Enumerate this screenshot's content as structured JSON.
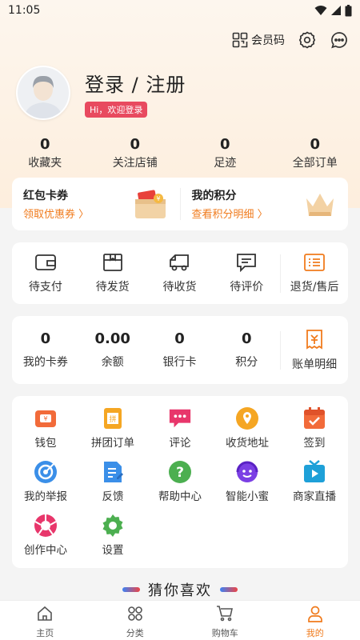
{
  "status_bar": {
    "time": "11:05"
  },
  "header": {
    "member_code_label": "会员码"
  },
  "profile": {
    "login_text": "登录 / 注册",
    "welcome_badge": "Hi，欢迎登录"
  },
  "stats": [
    {
      "value": "0",
      "label": "收藏夹"
    },
    {
      "value": "0",
      "label": "关注店铺"
    },
    {
      "value": "0",
      "label": "足迹"
    },
    {
      "value": "0",
      "label": "全部订单"
    }
  ],
  "promo": {
    "coupons": {
      "title": "红包卡券",
      "subtitle": "领取优惠券 〉"
    },
    "points": {
      "title": "我的积分",
      "subtitle": "查看积分明细 〉"
    }
  },
  "orders": [
    {
      "label": "待支付",
      "icon": "wallet-icon"
    },
    {
      "label": "待发货",
      "icon": "box-icon"
    },
    {
      "label": "待收货",
      "icon": "truck-icon"
    },
    {
      "label": "待评价",
      "icon": "comment-icon"
    },
    {
      "label": "退货/售后",
      "icon": "return-icon"
    }
  ],
  "wallet": [
    {
      "value": "0",
      "label": "我的卡券"
    },
    {
      "value": "0.00",
      "label": "余额"
    },
    {
      "value": "0",
      "label": "银行卡"
    },
    {
      "value": "0",
      "label": "积分"
    }
  ],
  "bill_detail_label": "账单明细",
  "services": [
    {
      "label": "钱包",
      "icon": "wallet-icon",
      "color": "#f26b3a"
    },
    {
      "label": "拼团订单",
      "icon": "group-order-icon",
      "color": "#f5a623"
    },
    {
      "label": "评论",
      "icon": "comment-icon",
      "color": "#e8366b"
    },
    {
      "label": "收货地址",
      "icon": "location-icon",
      "color": "#f5a623"
    },
    {
      "label": "签到",
      "icon": "calendar-check-icon",
      "color": "#f26b3a"
    },
    {
      "label": "我的举报",
      "icon": "target-icon",
      "color": "#3b8fe8"
    },
    {
      "label": "反馈",
      "icon": "feedback-icon",
      "color": "#3b8fe8"
    },
    {
      "label": "帮助中心",
      "icon": "help-icon",
      "color": "#4caf50"
    },
    {
      "label": "智能小蜜",
      "icon": "assistant-icon",
      "color": "#7b3fe4"
    },
    {
      "label": "商家直播",
      "icon": "live-icon",
      "color": "#1ea0d8"
    },
    {
      "label": "创作中心",
      "icon": "aperture-icon",
      "color": "#e8366b"
    },
    {
      "label": "设置",
      "icon": "gear-icon",
      "color": "#4caf50"
    }
  ],
  "guess_title": "猜你喜欢",
  "tabs": [
    {
      "label": "主页",
      "icon": "home-icon"
    },
    {
      "label": "分类",
      "icon": "category-icon"
    },
    {
      "label": "购物车",
      "icon": "cart-icon"
    },
    {
      "label": "我的",
      "icon": "user-icon",
      "active": true
    }
  ],
  "colors": {
    "accent": "#f07b1d",
    "badge": "#e84a5f"
  }
}
